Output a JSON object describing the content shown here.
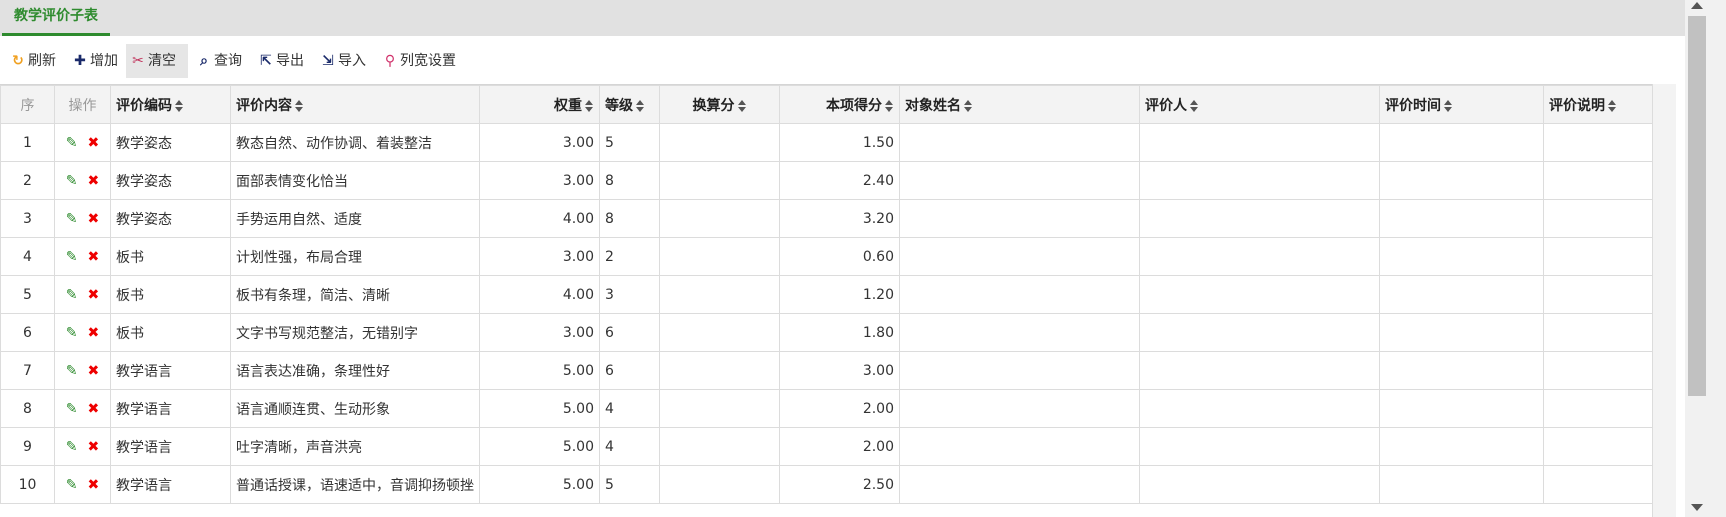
{
  "tab": {
    "label": "教学评价子表"
  },
  "toolbar": {
    "refresh": "刷新",
    "add": "增加",
    "clear": "清空",
    "query": "查询",
    "export": "导出",
    "import": "导入",
    "colwidth": "列宽设置"
  },
  "icons": {
    "refresh": "refresh-icon",
    "add": "plus-icon",
    "clear": "scissors-icon",
    "query": "search-icon",
    "export": "export-icon",
    "import": "import-icon",
    "colwidth": "pin-icon",
    "edit": "pencil-icon",
    "delete": "delete-icon"
  },
  "colors": {
    "accent": "#2e8b2e",
    "delete": "#e00000",
    "colwidth_icon": "#d0306a"
  },
  "columns": [
    "序",
    "操作",
    "评价编码",
    "评价内容",
    "权重",
    "等级",
    "换算分",
    "本项得分",
    "对象姓名",
    "评价人",
    "评价时间",
    "评价说明"
  ],
  "rows": [
    {
      "seq": "1",
      "code": "教学姿态",
      "content": "教态自然、动作协调、着装整洁",
      "weight": "3.00",
      "grade": "5",
      "convert": "",
      "score": "1.50"
    },
    {
      "seq": "2",
      "code": "教学姿态",
      "content": "面部表情变化恰当",
      "weight": "3.00",
      "grade": "8",
      "convert": "",
      "score": "2.40"
    },
    {
      "seq": "3",
      "code": "教学姿态",
      "content": "手势运用自然、适度",
      "weight": "4.00",
      "grade": "8",
      "convert": "",
      "score": "3.20"
    },
    {
      "seq": "4",
      "code": "板书",
      "content": "计划性强，布局合理",
      "weight": "3.00",
      "grade": "2",
      "convert": "",
      "score": "0.60"
    },
    {
      "seq": "5",
      "code": "板书",
      "content": "板书有条理，简洁、清晰",
      "weight": "4.00",
      "grade": "3",
      "convert": "",
      "score": "1.20"
    },
    {
      "seq": "6",
      "code": "板书",
      "content": "文字书写规范整洁，无错别字",
      "weight": "3.00",
      "grade": "6",
      "convert": "",
      "score": "1.80"
    },
    {
      "seq": "7",
      "code": "教学语言",
      "content": "语言表达准确，条理性好",
      "weight": "5.00",
      "grade": "6",
      "convert": "",
      "score": "3.00"
    },
    {
      "seq": "8",
      "code": "教学语言",
      "content": "语言通顺连贯、生动形象",
      "weight": "5.00",
      "grade": "4",
      "convert": "",
      "score": "2.00"
    },
    {
      "seq": "9",
      "code": "教学语言",
      "content": "吐字清晰，声音洪亮",
      "weight": "5.00",
      "grade": "4",
      "convert": "",
      "score": "2.00"
    },
    {
      "seq": "10",
      "code": "教学语言",
      "content": "普通话授课，语速适中，音调抑扬顿挫",
      "weight": "5.00",
      "grade": "5",
      "convert": "",
      "score": "2.50"
    }
  ]
}
